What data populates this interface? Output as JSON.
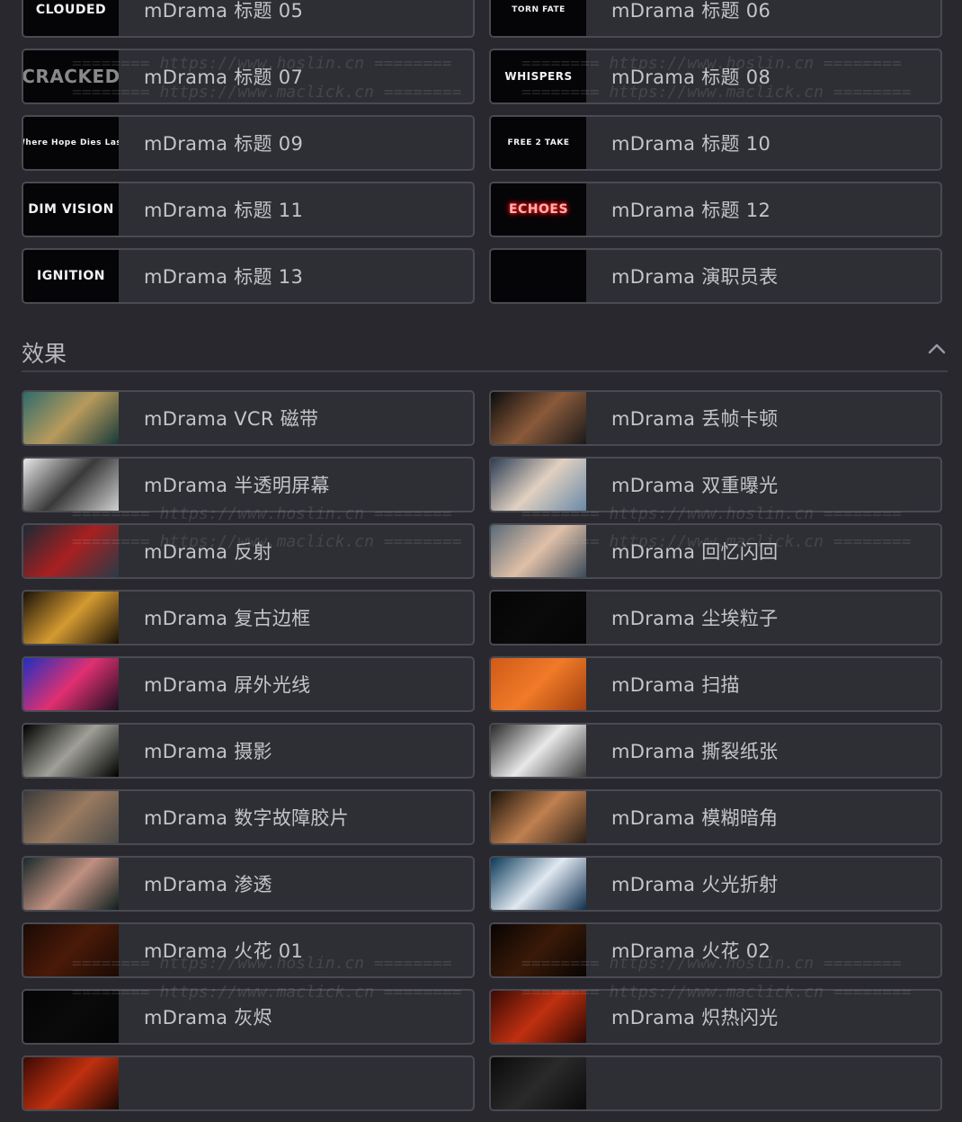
{
  "title_cards": [
    {
      "thumb": "CLOUDED",
      "label": "mDrama 标题 05",
      "style": ""
    },
    {
      "thumb": "TORN FATE",
      "label": "mDrama 标题 06",
      "style": "small"
    },
    {
      "thumb": "CRACKED",
      "label": "mDrama 标题 07",
      "style": "cracked"
    },
    {
      "thumb": "WHISPERS",
      "label": "mDrama 标题 08",
      "style": "whispers"
    },
    {
      "thumb": "Where Hope Dies Last",
      "label": "mDrama 标题 09",
      "style": "small"
    },
    {
      "thumb": "FREE 2 TAKE",
      "label": "mDrama 标题 10",
      "style": "small"
    },
    {
      "thumb": "DIM VISION",
      "label": "mDrama 标题 11",
      "style": ""
    },
    {
      "thumb": "ECHOES",
      "label": "mDrama 标题 12",
      "style": "echoes"
    },
    {
      "thumb": "IGNITION",
      "label": "mDrama 标题 13",
      "style": ""
    },
    {
      "thumb": "",
      "label": "mDrama 演职员表",
      "style": "credits"
    }
  ],
  "effects_section": {
    "title": "效果"
  },
  "effect_cards": [
    {
      "label": "mDrama VCR 磁带",
      "colors": [
        "#2f6c6a",
        "#b89a5c",
        "#173a3a"
      ]
    },
    {
      "label": "mDrama 丢帧卡顿",
      "colors": [
        "#0c0c0c",
        "#8a5a3a",
        "#1a1a1a"
      ]
    },
    {
      "label": "mDrama 半透明屏幕",
      "colors": [
        "#e8e8e8",
        "#3a3a3a",
        "#d0d0d0"
      ]
    },
    {
      "label": "mDrama 双重曝光",
      "colors": [
        "#2c3e54",
        "#e0d0c0",
        "#6a8aa8"
      ]
    },
    {
      "label": "mDrama 反射",
      "colors": [
        "#1a2a36",
        "#a82020",
        "#2a3a48"
      ]
    },
    {
      "label": "mDrama 回忆闪回",
      "colors": [
        "#5a6a78",
        "#e0c0a8",
        "#3a4a58"
      ]
    },
    {
      "label": "mDrama 复古边框",
      "colors": [
        "#1a1208",
        "#d49a30",
        "#1a1208"
      ]
    },
    {
      "label": "mDrama 尘埃粒子",
      "colors": [
        "#050505",
        "#0a0a0a",
        "#050505"
      ]
    },
    {
      "label": "mDrama 屏外光线",
      "colors": [
        "#2030c0",
        "#e03070",
        "#1a1020"
      ]
    },
    {
      "label": "mDrama 扫描",
      "colors": [
        "#d05a18",
        "#f07a28",
        "#a04010"
      ]
    },
    {
      "label": "mDrama 摄影",
      "colors": [
        "#000000",
        "#a0a098",
        "#000000"
      ]
    },
    {
      "label": "mDrama 撕裂纸张",
      "colors": [
        "#2a2a2a",
        "#e8e8e8",
        "#3a3a3a"
      ]
    },
    {
      "label": "mDrama 数字故障胶片",
      "colors": [
        "#3a3a3a",
        "#9a7a60",
        "#4a4a48"
      ]
    },
    {
      "label": "mDrama 模糊暗角",
      "colors": [
        "#1a1208",
        "#c08050",
        "#2a2018"
      ]
    },
    {
      "label": "mDrama 渗透",
      "colors": [
        "#1a2a2a",
        "#c09080",
        "#102020"
      ]
    },
    {
      "label": "mDrama 火光折射",
      "colors": [
        "#0a3a5a",
        "#e0e8f0",
        "#103050"
      ]
    },
    {
      "label": "mDrama 火花 01",
      "colors": [
        "#1a0a04",
        "#4a1a08",
        "#1a0a04"
      ]
    },
    {
      "label": "mDrama 火花 02",
      "colors": [
        "#080402",
        "#3a1a08",
        "#080402"
      ]
    },
    {
      "label": "mDrama 灰烬",
      "colors": [
        "#050505",
        "#0a0a0a",
        "#050505"
      ]
    },
    {
      "label": "mDrama 炽热闪光",
      "colors": [
        "#3a0a04",
        "#c03010",
        "#2a0804"
      ]
    }
  ],
  "partial_cards": [
    {
      "colors": [
        "#3a0a04",
        "#c03010",
        "#1a0804"
      ]
    },
    {
      "colors": [
        "#0a0a0a",
        "#2a2a2a",
        "#0a0a0a"
      ]
    }
  ],
  "watermarks": {
    "hoslin": "======== https://www.hoslin.cn ========",
    "maclick": "======== https://www.maclick.cn ========"
  },
  "icons": {
    "collapse": "chevron-up-icon"
  }
}
